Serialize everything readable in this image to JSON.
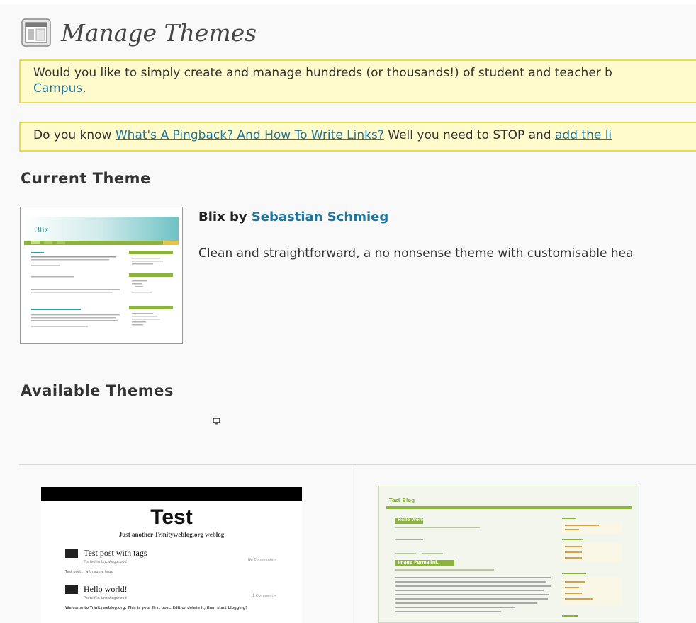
{
  "page": {
    "title": "Manage Themes",
    "icon": "themes-page-icon"
  },
  "notices": [
    {
      "before": "Would you like to simply create and manage hundreds (or thousands!) of student and teacher b",
      "link": "Campus",
      "after": "."
    },
    {
      "before": "Do you know ",
      "link1": "What's A Pingback? And How To Write Links?",
      "middle": " Well you need to STOP and ",
      "link2": "add the li"
    }
  ],
  "current_theme": {
    "heading": "Current Theme",
    "name": "Blix",
    "by": " by ",
    "author": "Sebastian Schmieg",
    "description": "Clean and straightforward, a no nonsense theme with customisable hea"
  },
  "available_themes": {
    "heading": "Available Themes",
    "themes": [
      {
        "blog_title": "Test",
        "tagline": "Just another Trinityweblog.org weblog",
        "posts": [
          {
            "title": "Test post with tags",
            "meta": "Posted in Uncategorized",
            "comments": "No Comments »",
            "excerpt": "Test post... with some tags."
          },
          {
            "title": "Hello world!",
            "meta": "Posted in Uncategorized",
            "comments": "1 Comment »",
            "excerpt": "Welcome to Trinityweblog.org. This is your first post. Edit or delete it, then start blogging!"
          }
        ]
      },
      {
        "blog_title": "Test Blog",
        "posts": [
          {
            "title": "Hello World"
          },
          {
            "title": "Image Permalink"
          }
        ]
      }
    ]
  },
  "colors": {
    "notice_bg": "#fffbcc",
    "notice_border": "#e6db55",
    "link": "#21759b",
    "blix_green": "#8db33f",
    "blix_teal": "#2a9fa0"
  }
}
